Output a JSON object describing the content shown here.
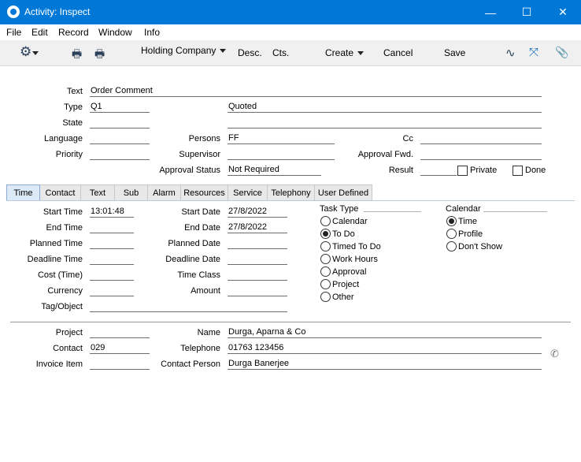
{
  "window": {
    "title": "Activity: Inspect",
    "minimize_glyph": "—",
    "maximize_glyph": "☐",
    "close_glyph": "✕"
  },
  "menu": [
    "File",
    "Edit",
    "Record",
    "Window",
    "Info"
  ],
  "toolbar": {
    "gear_glyph": "⚙",
    "print_glyph": "🖶",
    "preview_glyph": "🖶",
    "company": "Holding Company",
    "desc": "Desc.",
    "cts": "Cts.",
    "create": "Create",
    "cancel": "Cancel",
    "save": "Save",
    "activity_glyph": "∿",
    "expand_glyph": "⤧",
    "attach_glyph": "📎"
  },
  "header": {
    "text_label": "Text",
    "text_value": "Order Comment",
    "type_label": "Type",
    "type_value": "Q1",
    "type_desc": "Quoted",
    "state_label": "State",
    "state_value": "",
    "state_desc": "",
    "language_label": "Language",
    "language_value": "",
    "persons_label": "Persons",
    "persons_value": "FF",
    "cc_label": "Cc",
    "cc_value": "",
    "priority_label": "Priority",
    "priority_value": "",
    "supervisor_label": "Supervisor",
    "supervisor_value": "",
    "approval_fwd_label": "Approval Fwd.",
    "approval_fwd_value": "",
    "approval_status_label": "Approval Status",
    "approval_status_value": "Not Required",
    "result_label": "Result",
    "result_value": "",
    "private_label": "Private",
    "private_checked": false,
    "done_label": "Done",
    "done_checked": false
  },
  "tabs": [
    "Time",
    "Contact",
    "Text",
    "Sub",
    "Alarm",
    "Resources",
    "Service",
    "Telephony",
    "User Defined"
  ],
  "active_tab": "Time",
  "time_tab": {
    "start_time_label": "Start Time",
    "start_time": "13:01:48",
    "end_time_label": "End Time",
    "end_time": "",
    "planned_time_label": "Planned Time",
    "planned_time": "",
    "deadline_time_label": "Deadline Time",
    "deadline_time": "",
    "cost_time_label": "Cost (Time)",
    "cost_time": "",
    "currency_label": "Currency",
    "currency": "",
    "tag_label": "Tag/Object",
    "tag": "",
    "start_date_label": "Start Date",
    "start_date": "27/8/2022",
    "end_date_label": "End Date",
    "end_date": "27/8/2022",
    "planned_date_label": "Planned Date",
    "planned_date": "",
    "deadline_date_label": "Deadline Date",
    "deadline_date": "",
    "time_class_label": "Time Class",
    "time_class": "",
    "amount_label": "Amount",
    "amount": "",
    "task_type_title": "Task Type",
    "task_types": [
      "Calendar",
      "To Do",
      "Timed To Do",
      "Work Hours",
      "Approval",
      "Project",
      "Other"
    ],
    "task_type_selected": "To Do",
    "calendar_title": "Calendar",
    "calendar_options": [
      "Time",
      "Profile",
      "Don't Show"
    ],
    "calendar_selected": "Time"
  },
  "footer": {
    "project_label": "Project",
    "project": "",
    "contact_label": "Contact",
    "contact": "029",
    "invoice_item_label": "Invoice Item",
    "invoice_item": "",
    "name_label": "Name",
    "name": "Durga, Aparna & Co",
    "telephone_label": "Telephone",
    "telephone": "01763 123456",
    "contact_person_label": "Contact Person",
    "contact_person": "Durga Banerjee",
    "phone_glyph": "✆"
  }
}
